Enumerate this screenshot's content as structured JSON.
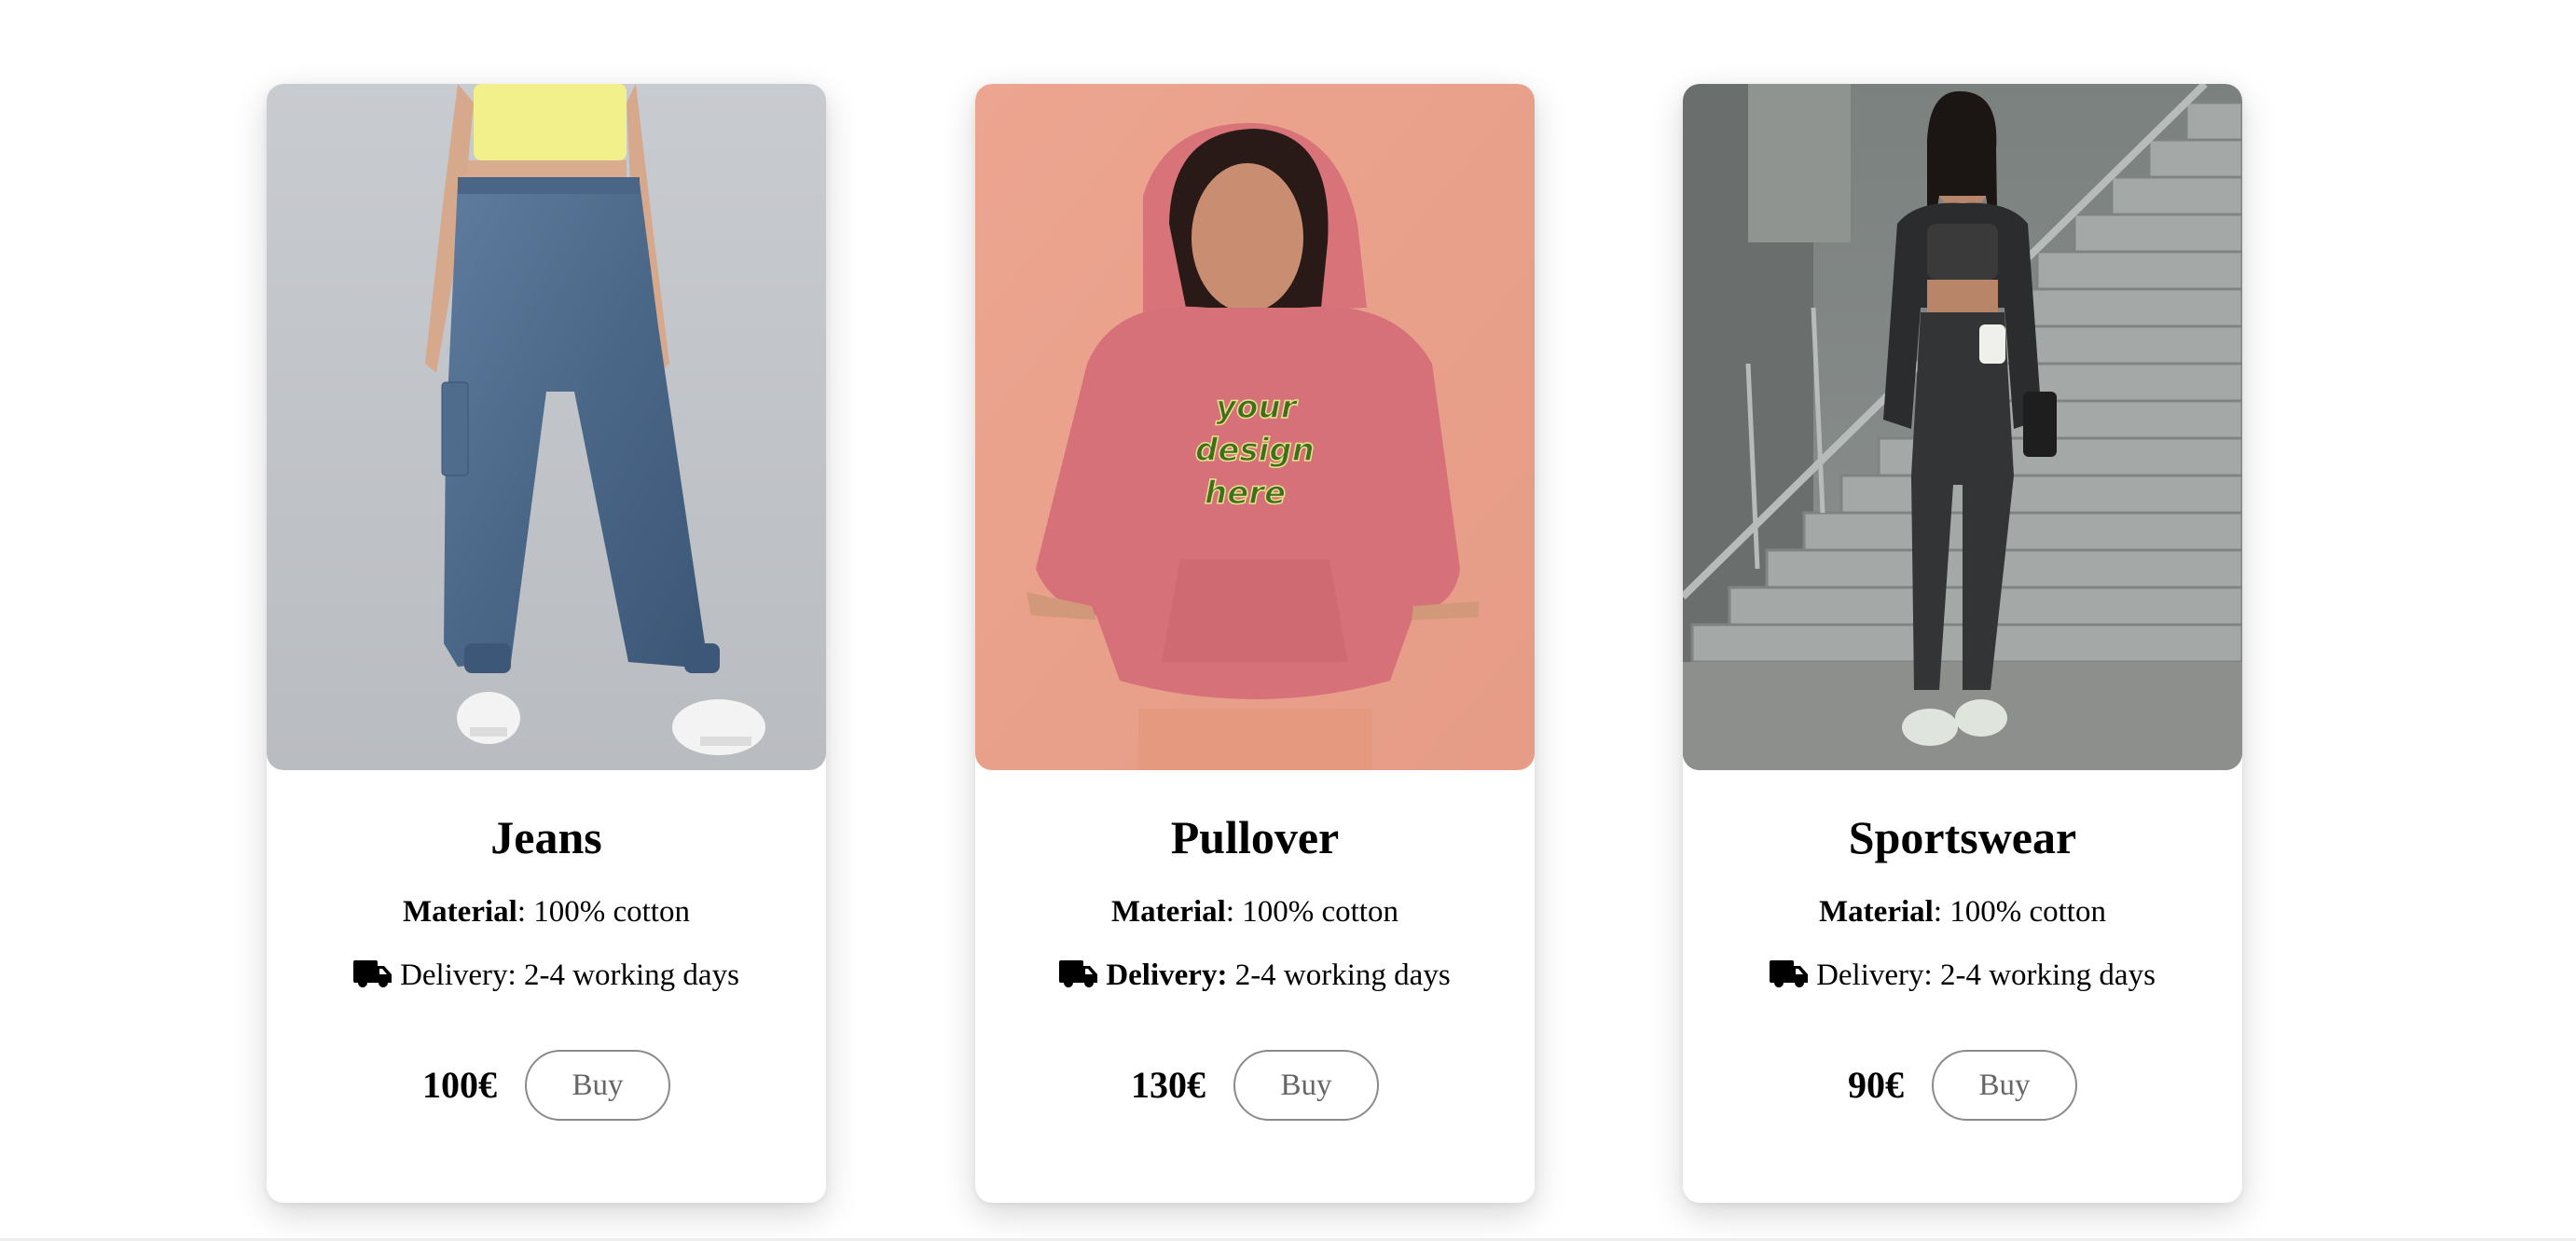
{
  "products": [
    {
      "title": "Jeans",
      "material_label": "Material",
      "material_value": ": 100% cotton",
      "delivery_label": "",
      "delivery_value": "Delivery: 2-4 working days",
      "price": "100€",
      "buy_label": "Buy",
      "image_icon": "photo-jeans"
    },
    {
      "title": "Pullover",
      "material_label": "Material",
      "material_value": ": 100% cotton",
      "delivery_label": "Delivery:",
      "delivery_value": " 2-4 working days",
      "price": "130€",
      "buy_label": "Buy",
      "image_icon": "photo-pullover",
      "print_text": [
        "your",
        "design",
        "here"
      ]
    },
    {
      "title": "Sportswear",
      "material_label": "Material",
      "material_value": ": 100% cotton",
      "delivery_label": "",
      "delivery_value": "Delivery: 2-4 working days",
      "price": "90€",
      "buy_label": "Buy",
      "image_icon": "photo-sportswear"
    }
  ],
  "colors": {
    "jeans_bg": "#c4c7cc",
    "pullover_bg": "#e9a590",
    "sportswear_bg": "#7d8481",
    "button_border": "#8a8a8a"
  }
}
